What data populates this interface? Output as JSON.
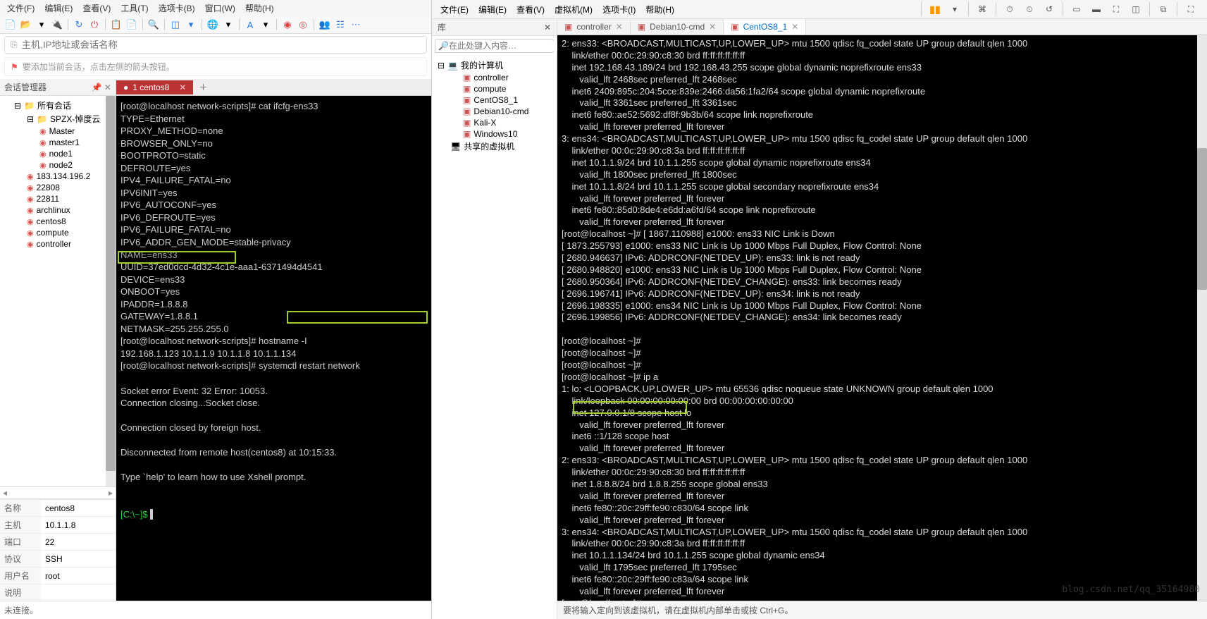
{
  "xshell": {
    "menu": [
      "文件(F)",
      "编辑(E)",
      "查看(V)",
      "工具(T)",
      "选项卡(B)",
      "窗口(W)",
      "帮助(H)"
    ],
    "addr_placeholder": "主机,IP地址或会话名称",
    "hint_text": "要添加当前会话，点击左侧的箭头按钮。",
    "side_title": "会话管理器",
    "tree": {
      "root": "所有会话",
      "folder1": "SPZX-悼度云",
      "items": [
        "Master",
        "master1",
        "node1",
        "node2",
        "183.134.196.2",
        "22808",
        "22811",
        "archlinux",
        "centos8",
        "compute",
        "controller"
      ]
    },
    "props": {
      "名称": "centos8",
      "主机": "10.1.1.8",
      "端口": "22",
      "协议": "SSH",
      "用户名": "root",
      "说明": ""
    },
    "status": "未连接。",
    "tab_label": "1 centos8",
    "terminal_lines": [
      "[root@localhost network-scripts]# cat ifcfg-ens33",
      "TYPE=Ethernet",
      "PROXY_METHOD=none",
      "BROWSER_ONLY=no",
      "BOOTPROTO=static",
      "DEFROUTE=yes",
      "IPV4_FAILURE_FATAL=no",
      "IPV6INIT=yes",
      "IPV6_AUTOCONF=yes",
      "IPV6_DEFROUTE=yes",
      "IPV6_FAILURE_FATAL=no",
      "IPV6_ADDR_GEN_MODE=stable-privacy",
      "NAME=ens33",
      "UUID=37ed0dcd-4d32-4c1e-aaa1-6371494d4541",
      "DEVICE=ens33",
      "ONBOOT=yes",
      "IPADDR=1.8.8.8",
      "GATEWAY=1.8.8.1",
      "NETMASK=255.255.255.0",
      "[root@localhost network-scripts]# hostname -I",
      "192.168.1.123 10.1.1.9 10.1.1.8 10.1.1.134 ",
      "[root@localhost network-scripts]# systemctl restart network",
      "",
      "Socket error Event: 32 Error: 10053.",
      "Connection closing...Socket close.",
      "",
      "Connection closed by foreign host.",
      "",
      "Disconnected from remote host(centos8) at 10:15:33.",
      "",
      "Type `help' to learn how to use Xshell prompt."
    ],
    "prompt": "[C:\\~]$ ",
    "highlight1": "IPADDR=1.8.8.8",
    "highlight2": "systemctl restart network"
  },
  "vmware": {
    "menu": [
      "文件(E)",
      "编辑(E)",
      "查看(V)",
      "虚拟机(M)",
      "选项卡(I)",
      "帮助(H)"
    ],
    "lib_title": "库",
    "search_placeholder": "在此处键入内容…",
    "tree": {
      "root": "我的计算机",
      "items": [
        "controller",
        "compute",
        "CentOS8_1",
        "Debian10-cmd",
        "Kali-X",
        "Windows10"
      ],
      "shared": "共享的虚拟机"
    },
    "tabs": [
      "controller",
      "Debian10-cmd",
      "CentOS8_1"
    ],
    "active_tab": 2,
    "terminal_lines": [
      "2: ens33: <BROADCAST,MULTICAST,UP,LOWER_UP> mtu 1500 qdisc fq_codel state UP group default qlen 1000",
      "    link/ether 00:0c:29:90:c8:30 brd ff:ff:ff:ff:ff:ff",
      "    inet 192.168.43.189/24 brd 192.168.43.255 scope global dynamic noprefixroute ens33",
      "       valid_lft 2468sec preferred_lft 2468sec",
      "    inet6 2409:895c:204:5cce:839e:2466:da56:1fa2/64 scope global dynamic noprefixroute",
      "       valid_lft 3361sec preferred_lft 3361sec",
      "    inet6 fe80::ae52:5692:df8f:9b3b/64 scope link noprefixroute",
      "       valid_lft forever preferred_lft forever",
      "3: ens34: <BROADCAST,MULTICAST,UP,LOWER_UP> mtu 1500 qdisc fq_codel state UP group default qlen 1000",
      "    link/ether 00:0c:29:90:c8:3a brd ff:ff:ff:ff:ff:ff",
      "    inet 10.1.1.9/24 brd 10.1.1.255 scope global dynamic noprefixroute ens34",
      "       valid_lft 1800sec preferred_lft 1800sec",
      "    inet 10.1.1.8/24 brd 10.1.1.255 scope global secondary noprefixroute ens34",
      "       valid_lft forever preferred_lft forever",
      "    inet6 fe80::85d0:8de4:e6dd:a6fd/64 scope link noprefixroute",
      "       valid_lft forever preferred_lft forever",
      "[root@localhost ~]# [ 1867.110988] e1000: ens33 NIC Link is Down",
      "[ 1873.255793] e1000: ens33 NIC Link is Up 1000 Mbps Full Duplex, Flow Control: None",
      "[ 2680.946637] IPv6: ADDRCONF(NETDEV_UP): ens33: link is not ready",
      "[ 2680.948820] e1000: ens33 NIC Link is Up 1000 Mbps Full Duplex, Flow Control: None",
      "[ 2680.950364] IPv6: ADDRCONF(NETDEV_CHANGE): ens33: link becomes ready",
      "[ 2696.196741] IPv6: ADDRCONF(NETDEV_UP): ens34: link is not ready",
      "[ 2696.198335] e1000: ens34 NIC Link is Up 1000 Mbps Full Duplex, Flow Control: None",
      "[ 2696.199856] IPv6: ADDRCONF(NETDEV_CHANGE): ens34: link becomes ready",
      "",
      "[root@localhost ~]#",
      "[root@localhost ~]#",
      "[root@localhost ~]#",
      "[root@localhost ~]# ip a",
      "1: lo: <LOOPBACK,UP,LOWER_UP> mtu 65536 qdisc noqueue state UNKNOWN group default qlen 1000",
      "    link/loopback 00:00:00:00:00:00 brd 00:00:00:00:00:00",
      "    inet 127.0.0.1/8 scope host lo",
      "       valid_lft forever preferred_lft forever",
      "    inet6 ::1/128 scope host",
      "       valid_lft forever preferred_lft forever",
      "2: ens33: <BROADCAST,MULTICAST,UP,LOWER_UP> mtu 1500 qdisc fq_codel state UP group default qlen 1000",
      "    link/ether 00:0c:29:90:c8:30 brd ff:ff:ff:ff:ff:ff",
      "    inet 1.8.8.8/24 brd 1.8.8.255 scope global ens33",
      "       valid_lft forever preferred_lft forever",
      "    inet6 fe80::20c:29ff:fe90:c830/64 scope link",
      "       valid_lft forever preferred_lft forever",
      "3: ens34: <BROADCAST,MULTICAST,UP,LOWER_UP> mtu 1500 qdisc fq_codel state UP group default qlen 1000",
      "    link/ether 00:0c:29:90:c8:3a brd ff:ff:ff:ff:ff:ff",
      "    inet 10.1.1.134/24 brd 10.1.1.255 scope global dynamic ens34",
      "       valid_lft 1795sec preferred_lft 1795sec",
      "    inet6 fe80::20c:29ff:fe90:c83a/64 scope link",
      "       valid_lft forever preferred_lft forever",
      "[root@localhost ~]#"
    ],
    "highlight": "inet 1.8.8.8/24 brd ",
    "footer": "要将输入定向到该虚拟机，请在虚拟机内部单击或按 Ctrl+G。",
    "watermark": "blog.csdn.net/qq_35164980"
  }
}
